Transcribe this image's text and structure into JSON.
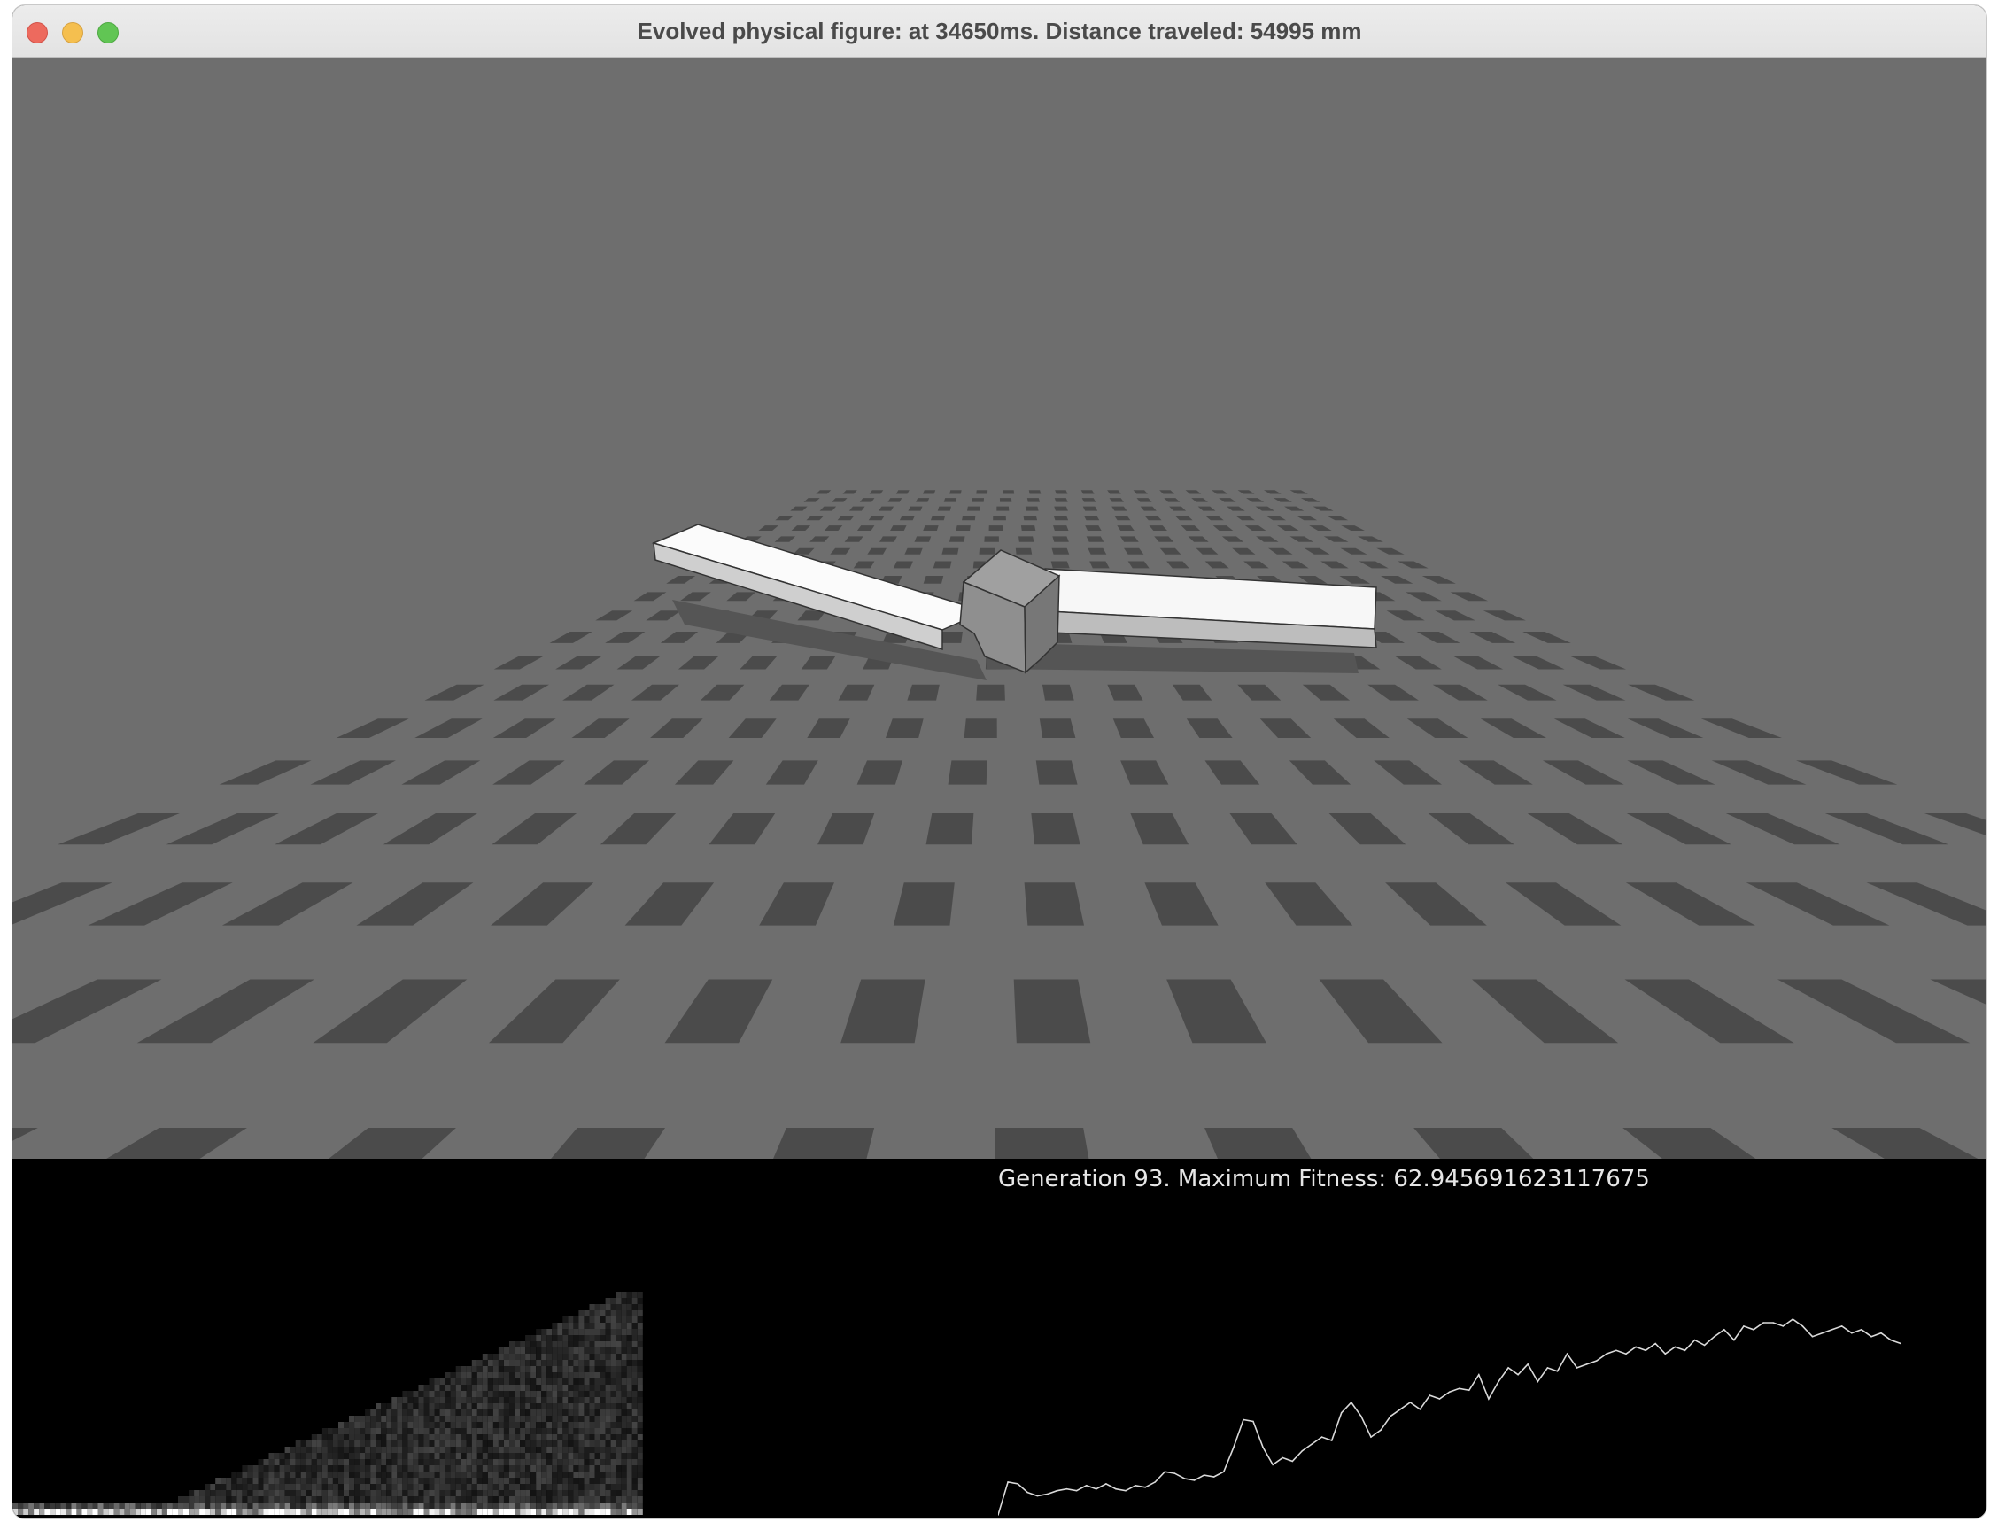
{
  "window": {
    "title": "Evolved physical figure: at 34650ms. Distance traveled: 54995 mm"
  },
  "scene": {
    "floor_color": "#6e6e6e",
    "tile_color": "#4b4b4b",
    "creature_color": "#f5f5f5"
  },
  "stats": {
    "generation_text": "Generation 93. Maximum Fitness: 62.945691623117675"
  },
  "chart_data": {
    "type": "line",
    "title": "",
    "xlabel": "",
    "ylabel": "",
    "x_range": [
      1,
      93
    ],
    "ylim": [
      0,
      67
    ],
    "series": [
      {
        "values": [
          0.5,
          10,
          9.5,
          7,
          6,
          6.5,
          7.5,
          8,
          7.5,
          9,
          8,
          9.5,
          8,
          7.5,
          9,
          8.5,
          10,
          13,
          12.5,
          11,
          10.5,
          12,
          11.5,
          13,
          20,
          28,
          27.5,
          20,
          15,
          17,
          16,
          19,
          21,
          23,
          22,
          30,
          33,
          29,
          23,
          25,
          29,
          31,
          33,
          31,
          35,
          34,
          36,
          37,
          36.5,
          41,
          34,
          39,
          43,
          41,
          44,
          39,
          43,
          42,
          47,
          43,
          44,
          45,
          47,
          48,
          47,
          49,
          48,
          50,
          47,
          49,
          48,
          51,
          49.5,
          52,
          54,
          51,
          55,
          54,
          56,
          56,
          55,
          57,
          55,
          52,
          53,
          54,
          55,
          53,
          54,
          52,
          53,
          51,
          50
        ]
      }
    ]
  }
}
